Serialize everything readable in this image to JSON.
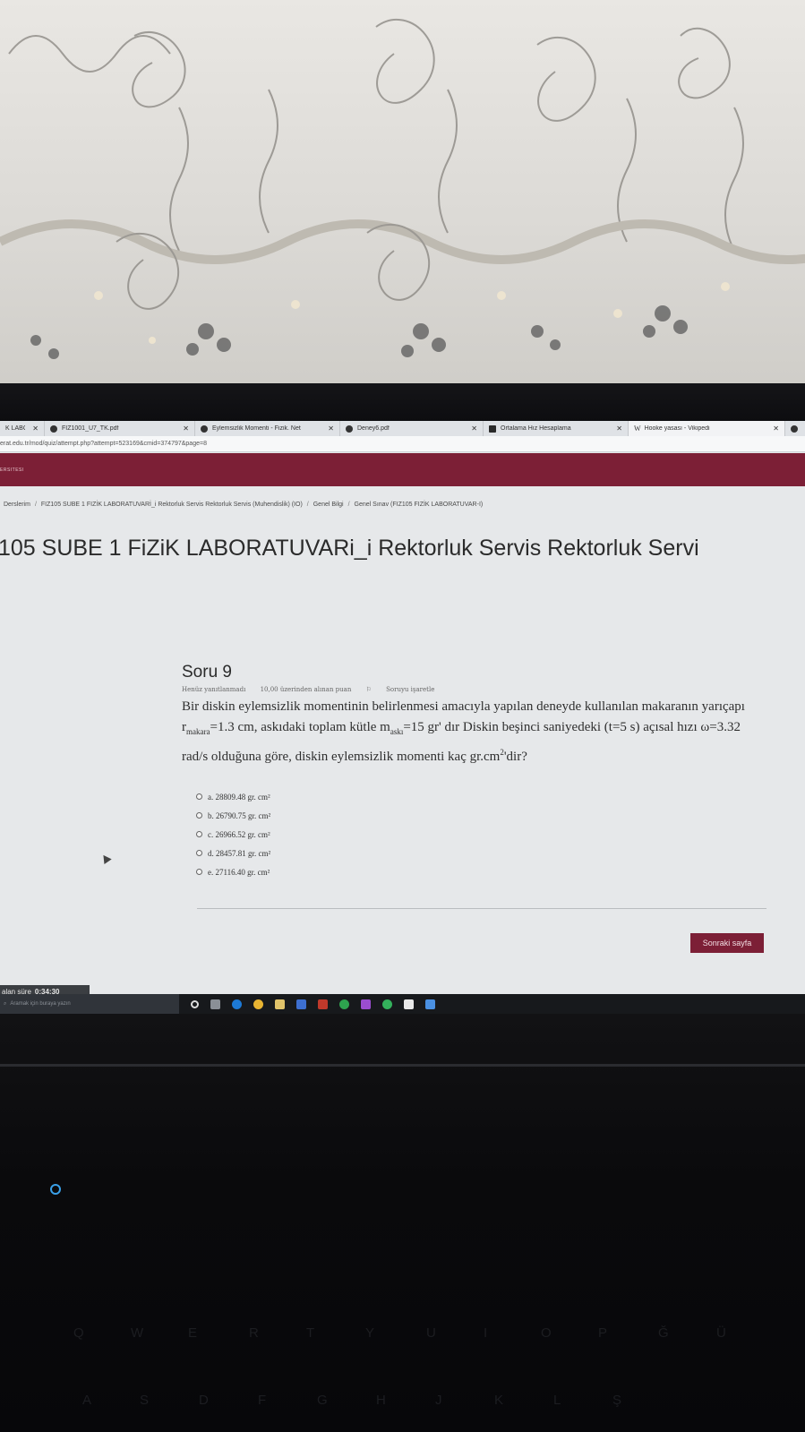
{
  "browser": {
    "tabs": [
      {
        "label": "K LABO",
        "icon": "moodle-icon"
      },
      {
        "label": "FIZ1001_U7_TK.pdf",
        "icon": "globe-icon"
      },
      {
        "label": "Eylemsizlik Momenti - Fizik. Net",
        "icon": "globe-icon"
      },
      {
        "label": "Deney6.pdf",
        "icon": "globe-icon"
      },
      {
        "label": "Ortalama Hız Hesaplama",
        "icon": "calculator-icon"
      },
      {
        "label": "Hooke yasası - Vikipedi",
        "icon": "wikipedia-icon"
      }
    ],
    "url": "erat.edu.tr/mod/quiz/attempt.php?attempt=523169&cmid=374797&page=8"
  },
  "header": {
    "brand": "ERSITESI"
  },
  "breadcrumb": [
    "Derslerim",
    "FIZ105 SUBE 1 FIZİK LABORATUVARİ_i Rektorluk Servis Rektorluk Servis (Muhendislik) (IO)",
    "Genel Bilgi",
    "Genel Sınav (FIZ105 FIZİK LABORATUVAR-I)"
  ],
  "course": {
    "title": "105 SUBE 1 FiZiK LABORATUVARi_i Rektorluk Servis Rektorluk Servi",
    "title_line2": ")"
  },
  "question": {
    "title": "Soru 9",
    "status": "Henüz yanıtlanmadı",
    "points": "10,00 üzerinden alınan puan",
    "flag": "Soruyu işaretle",
    "text": "Bir diskin eylemsizlik momentinin belirlenmesi amacıyla yapılan deneyde kullanılan makaranın yarıçapı r",
    "sub1": "makara",
    "text2": "=1.3 cm, askıdaki toplam kütle m",
    "sub2": "askı",
    "text3": "=15 gr' dır Diskin beşinci saniyedeki (t=5 s) açısal hızı ω=3.32 rad/s olduğuna göre, diskin eylemsizlik momenti kaç gr.cm",
    "sup": "2",
    "text4": "'dir?",
    "options": [
      "a. 28809.48 gr. cm²",
      "b. 26790.75 gr. cm²",
      "c. 26966.52 gr. cm²",
      "d. 28457.81 gr. cm²",
      "e. 27116.40 gr. cm²"
    ]
  },
  "next_button": "Sonraki sayfa",
  "timer": {
    "label": "alan süre",
    "value": "0:34:30"
  },
  "taskbar": {
    "search_placeholder": "Aramak için buraya yazın"
  },
  "keyboard_keys": [
    "Q",
    "W",
    "E",
    "R",
    "T",
    "Y",
    "U",
    "I",
    "O",
    "P",
    "Ğ",
    "Ü",
    "A",
    "S",
    "D",
    "F",
    "G",
    "H",
    "J",
    "K",
    "L",
    "Ş"
  ],
  "colors": {
    "brand": "#7c1f36",
    "taskbar": "#17191c"
  }
}
